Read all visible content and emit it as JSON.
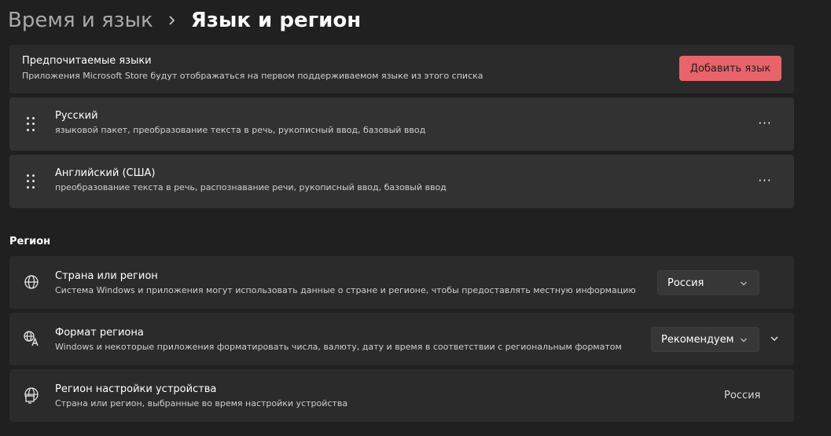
{
  "breadcrumb": {
    "parent": "Время и язык",
    "current": "Язык и регион"
  },
  "preferred": {
    "title": "Предпочитаемые языки",
    "subtitle": "Приложения Microsoft Store будут отображаться на первом поддерживаемом языке из этого списка",
    "add_button": "Добавить язык"
  },
  "languages": [
    {
      "name": "Русский",
      "features": "языковой пакет, преобразование текста в речь, рукописный ввод, базовый ввод",
      "menu": "···"
    },
    {
      "name": "Английский (США)",
      "features": "преобразование текста в речь, распознавание речи, рукописный ввод, базовый ввод",
      "menu": "···"
    }
  ],
  "region": {
    "section_label": "Регион",
    "country": {
      "title": "Страна или регион",
      "subtitle": "Система Windows и приложения могут использовать данные о стране и регионе, чтобы предоставлять местную информацию",
      "value": "Россия",
      "icon": "globe-icon"
    },
    "format": {
      "title": "Формат региона",
      "subtitle": "Windows и некоторые приложения форматировать числа, валюту, дату и время в соответствии с региональным форматом",
      "value": "Рекомендуем",
      "icon": "language-format-icon"
    },
    "setup": {
      "title": "Регион настройки устройства",
      "subtitle": "Страна или регион, выбранные во время настройки устройства",
      "value": "Россия",
      "icon": "globe-pc-icon"
    }
  },
  "colors": {
    "background": "#202020",
    "card": "#2b2b2b",
    "accent": "#e8646a"
  }
}
